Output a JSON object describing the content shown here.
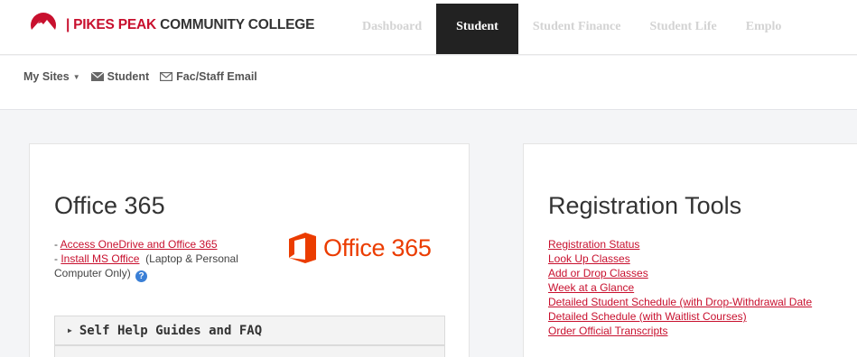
{
  "header": {
    "logo_separator": "|",
    "logo_red": "PIKES PEAK",
    "logo_dark": " COMMUNITY COLLEGE",
    "nav": [
      "Dashboard",
      "Student",
      "Student Finance",
      "Student Life",
      "Emplo"
    ]
  },
  "subnav": {
    "my_sites": "My Sites",
    "student": "Student",
    "fac_staff_email": "Fac/Staff Email"
  },
  "office365": {
    "title": "Office 365",
    "link1": "Access OneDrive and Office 365",
    "link2": "Install MS Office",
    "note": "(Laptop & Personal Computer Only)",
    "help_glyph": "?",
    "logo_text": "Office 365",
    "accordion_label": "Self Help Guides and FAQ"
  },
  "registration": {
    "title": "Registration Tools",
    "links": [
      "Registration Status",
      "Look Up Classes",
      "Add or Drop Classes",
      "Week at a Glance",
      "Detailed Student Schedule (with Drop-Withdrawal Date",
      "Detailed Schedule (with Waitlist Courses)",
      "Order Official Transcripts"
    ]
  },
  "colors": {
    "brand_red": "#c8102e",
    "office_orange": "#eb3c00",
    "nav_active_bg": "#222222"
  }
}
